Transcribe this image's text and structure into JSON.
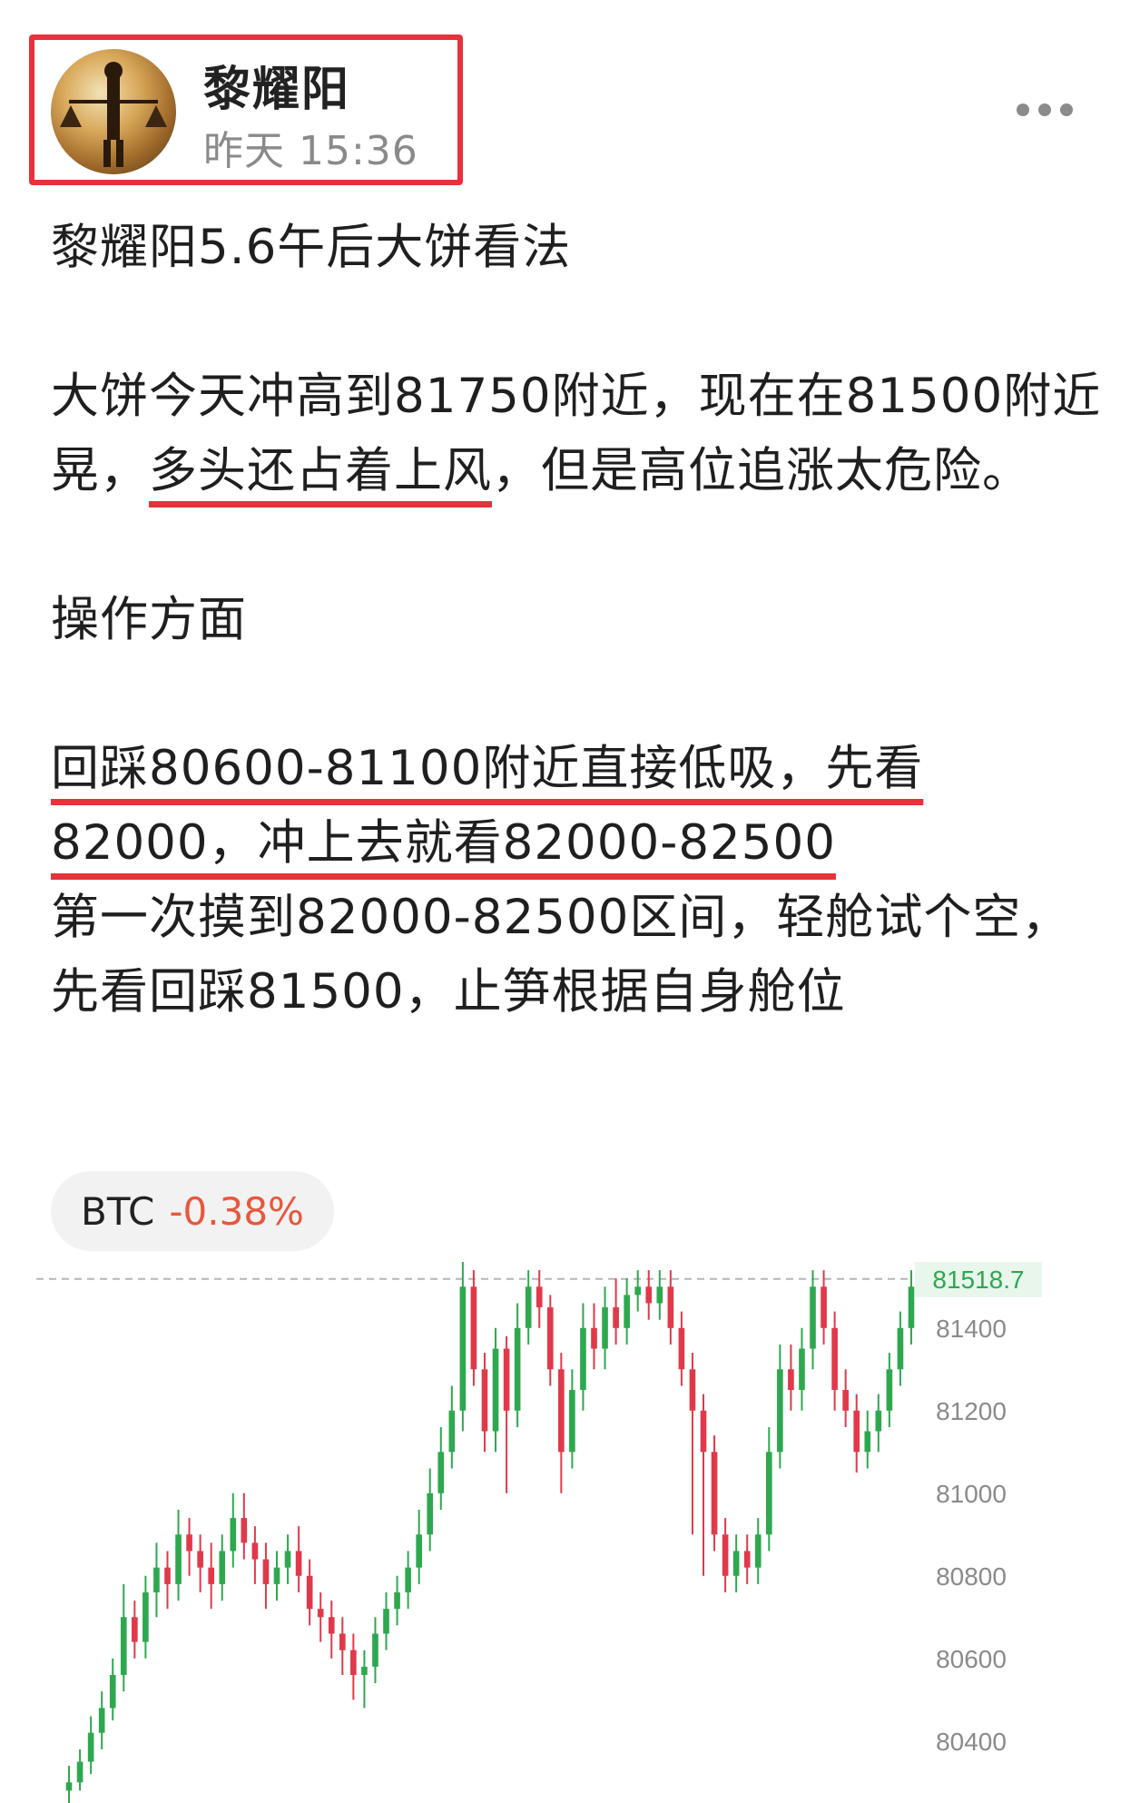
{
  "header": {
    "username": "黎耀阳",
    "timestamp": "昨天 15:36",
    "avatar_icon": "avatar-person-scales-icon",
    "more_icon": "more-dots-icon",
    "highlight_color": "#e5323b"
  },
  "post": {
    "title": "黎耀阳5.6午后大饼看法",
    "para1_a": "大饼今天冲高到81750附近，现在在81500附近晃，",
    "para1_ul": "多头还占着上风",
    "para1_b": "，但是高位追涨太危险。",
    "section": "操作方面",
    "line1_ul": "回踩80600-81100附近直接低吸，先看82000，冲上去就看82000-82500",
    "line2": "第一次摸到82000-82500区间，轻舱试个空，先看回踩81500，止笋根据自身舱位"
  },
  "ticker": {
    "symbol": "BTC",
    "change": "-0.38%",
    "change_color": "#e8573c"
  },
  "chart_data": {
    "type": "candlestick",
    "current_price": "81518.7",
    "y_ticks": [
      "81400",
      "81200",
      "81000",
      "80800",
      "80600",
      "80400"
    ],
    "ylim": [
      80250,
      81560
    ],
    "up_color": "#2ea84f",
    "down_color": "#e0394a",
    "candles": [
      [
        80280,
        80300,
        80200,
        80340
      ],
      [
        80300,
        80350,
        80280,
        80380
      ],
      [
        80350,
        80420,
        80320,
        80460
      ],
      [
        80420,
        80480,
        80380,
        80520
      ],
      [
        80480,
        80560,
        80450,
        80600
      ],
      [
        80560,
        80700,
        80520,
        80780
      ],
      [
        80700,
        80640,
        80600,
        80740
      ],
      [
        80640,
        80760,
        80600,
        80800
      ],
      [
        80760,
        80820,
        80700,
        80880
      ],
      [
        80820,
        80780,
        80720,
        80860
      ],
      [
        80780,
        80900,
        80740,
        80960
      ],
      [
        80900,
        80860,
        80800,
        80940
      ],
      [
        80860,
        80820,
        80760,
        80900
      ],
      [
        80820,
        80780,
        80720,
        80880
      ],
      [
        80780,
        80860,
        80740,
        80900
      ],
      [
        80860,
        80940,
        80820,
        81000
      ],
      [
        80940,
        80880,
        80840,
        81000
      ],
      [
        80880,
        80840,
        80780,
        80920
      ],
      [
        80840,
        80780,
        80720,
        80880
      ],
      [
        80780,
        80820,
        80740,
        80860
      ],
      [
        80820,
        80860,
        80780,
        80900
      ],
      [
        80860,
        80800,
        80760,
        80920
      ],
      [
        80800,
        80720,
        80680,
        80840
      ],
      [
        80720,
        80700,
        80640,
        80760
      ],
      [
        80700,
        80660,
        80600,
        80740
      ],
      [
        80660,
        80620,
        80560,
        80700
      ],
      [
        80620,
        80560,
        80500,
        80660
      ],
      [
        80560,
        80580,
        80480,
        80620
      ],
      [
        80580,
        80660,
        80540,
        80700
      ],
      [
        80660,
        80720,
        80620,
        80760
      ],
      [
        80720,
        80760,
        80680,
        80800
      ],
      [
        80760,
        80820,
        80720,
        80860
      ],
      [
        80820,
        80900,
        80780,
        80960
      ],
      [
        80900,
        81000,
        80860,
        81060
      ],
      [
        81000,
        81100,
        80960,
        81160
      ],
      [
        81100,
        81200,
        81060,
        81260
      ],
      [
        81200,
        81500,
        81150,
        81560
      ],
      [
        81500,
        81300,
        81260,
        81540
      ],
      [
        81300,
        81150,
        81100,
        81340
      ],
      [
        81150,
        81350,
        81100,
        81400
      ],
      [
        81350,
        81200,
        81000,
        81380
      ],
      [
        81200,
        81400,
        81160,
        81460
      ],
      [
        81400,
        81500,
        81360,
        81540
      ],
      [
        81500,
        81450,
        81400,
        81540
      ],
      [
        81450,
        81300,
        81260,
        81480
      ],
      [
        81300,
        81100,
        81000,
        81340
      ],
      [
        81100,
        81250,
        81060,
        81300
      ],
      [
        81250,
        81400,
        81200,
        81460
      ],
      [
        81400,
        81350,
        81300,
        81460
      ],
      [
        81350,
        81450,
        81300,
        81500
      ],
      [
        81450,
        81400,
        81360,
        81520
      ],
      [
        81400,
        81480,
        81360,
        81520
      ],
      [
        81480,
        81500,
        81440,
        81540
      ],
      [
        81500,
        81460,
        81420,
        81540
      ],
      [
        81460,
        81500,
        81420,
        81540
      ],
      [
        81500,
        81400,
        81360,
        81540
      ],
      [
        81400,
        81300,
        81260,
        81440
      ],
      [
        81300,
        81200,
        80900,
        81340
      ],
      [
        81200,
        81100,
        80800,
        81240
      ],
      [
        81100,
        80900,
        80860,
        81140
      ],
      [
        80900,
        80800,
        80760,
        80940
      ],
      [
        80800,
        80860,
        80760,
        80900
      ],
      [
        80860,
        80820,
        80780,
        80900
      ],
      [
        80820,
        80900,
        80780,
        80940
      ],
      [
        80900,
        81100,
        80860,
        81160
      ],
      [
        81100,
        81300,
        81060,
        81360
      ],
      [
        81300,
        81250,
        81200,
        81360
      ],
      [
        81250,
        81350,
        81200,
        81400
      ],
      [
        81350,
        81500,
        81300,
        81540
      ],
      [
        81500,
        81400,
        81360,
        81540
      ],
      [
        81400,
        81250,
        81200,
        81440
      ],
      [
        81250,
        81200,
        81160,
        81300
      ],
      [
        81200,
        81100,
        81050,
        81240
      ],
      [
        81100,
        81150,
        81060,
        81200
      ],
      [
        81150,
        81200,
        81100,
        81240
      ],
      [
        81200,
        81300,
        81160,
        81340
      ],
      [
        81300,
        81400,
        81260,
        81440
      ],
      [
        81400,
        81500,
        81360,
        81540
      ]
    ]
  }
}
